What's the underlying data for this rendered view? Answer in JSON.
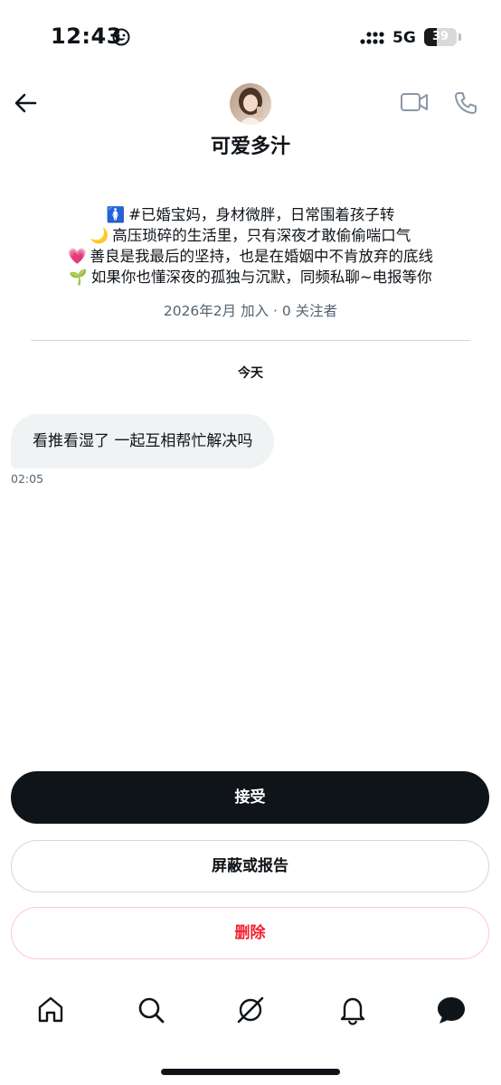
{
  "status_bar": {
    "time": "12:43",
    "network": "5G",
    "battery": "39",
    "battery_fraction": 0.39,
    "icons": [
      "smiley-icon",
      "signal-icon",
      "battery-icon"
    ]
  },
  "header": {
    "back_icon": "arrow-left-icon",
    "name": "可爱多汁",
    "actions": [
      "video-call-icon",
      "phone-call-icon"
    ]
  },
  "profile": {
    "bio": [
      {
        "emoji": "🚺",
        "text": "#已婚宝妈，身材微胖，日常围着孩子转"
      },
      {
        "emoji": "🌙",
        "text": "高压琐碎的生活里，只有深夜才敢偷偷喘口气"
      },
      {
        "emoji": "💗",
        "text": "善良是我最后的坚持，也是在婚姻中不肯放弃的底线"
      },
      {
        "emoji": "🌱",
        "text": "如果你也懂深夜的孤独与沉默，同频私聊~电报等你"
      }
    ],
    "joined": "2026年2月 加入 · 0 关注者"
  },
  "conversation": {
    "date_label": "今天",
    "messages": [
      {
        "text": "看推看湿了 一起互相帮忙解决吗",
        "time": "02:05"
      }
    ]
  },
  "actions": {
    "accept": "接受",
    "block_or_report": "屏蔽或报告",
    "delete": "删除"
  },
  "bottom_nav": [
    "home-icon",
    "search-icon",
    "grok-icon",
    "notifications-icon",
    "messages-icon"
  ],
  "colors": {
    "primary_text": "#0f1419",
    "secondary_text": "#536471",
    "danger": "#f4212e",
    "bubble_bg": "#eff3f4",
    "divider": "#cfd9de"
  }
}
